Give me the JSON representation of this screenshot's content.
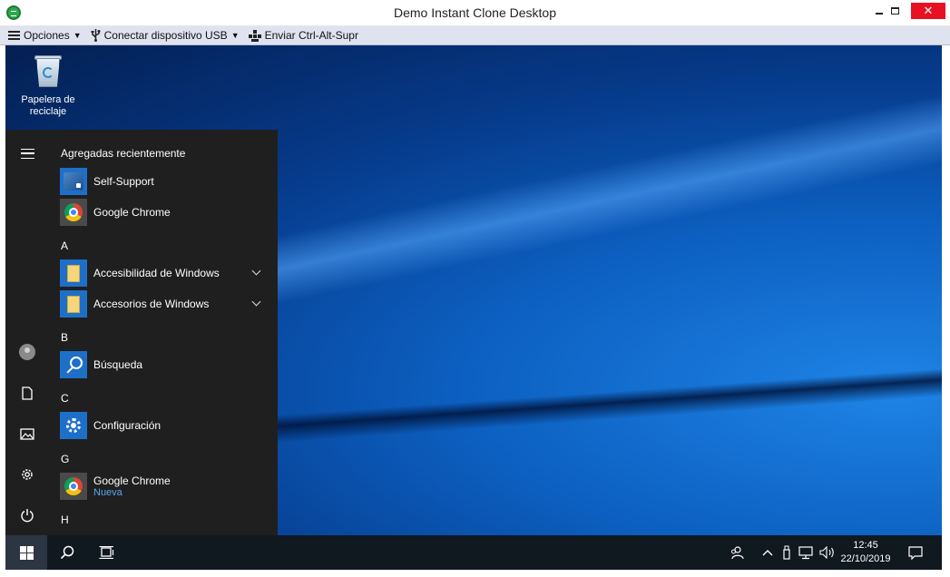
{
  "window": {
    "title": "Demo Instant Clone Desktop",
    "controls": {
      "minimize": "minimize",
      "maximize": "maximize",
      "close": "✕"
    }
  },
  "toolbar": {
    "options_label": "Opciones",
    "usb_label": "Conectar dispositivo USB",
    "ctrl_alt_del_label": "Enviar Ctrl-Alt-Supr"
  },
  "desktop": {
    "recycle_bin_label": "Papelera de reciclaje"
  },
  "start_menu": {
    "recent_heading": "Agregadas recientemente",
    "recent_apps": [
      {
        "label": "Self-Support",
        "icon": "self-support-icon"
      },
      {
        "label": "Google Chrome",
        "icon": "chrome-icon"
      }
    ],
    "groups": [
      {
        "letter": "A",
        "items": [
          {
            "label": "Accesibilidad de Windows",
            "icon": "folder-icon",
            "expandable": true
          },
          {
            "label": "Accesorios de Windows",
            "icon": "folder-icon",
            "expandable": true
          }
        ]
      },
      {
        "letter": "B",
        "items": [
          {
            "label": "Búsqueda",
            "icon": "search-icon"
          }
        ]
      },
      {
        "letter": "C",
        "items": [
          {
            "label": "Configuración",
            "icon": "gear-icon"
          }
        ]
      },
      {
        "letter": "G",
        "items": [
          {
            "label": "Google Chrome",
            "sub": "Nueva",
            "icon": "chrome-icon"
          }
        ]
      },
      {
        "letter": "H",
        "items": []
      }
    ],
    "rail_icons": [
      "menu-icon",
      "user-icon",
      "documents-icon",
      "pictures-icon",
      "settings-icon",
      "power-icon"
    ]
  },
  "taskbar": {
    "tray_icons": [
      "people-icon",
      "chevron-up-icon",
      "usb-icon",
      "network-icon",
      "volume-icon",
      "notifications-icon"
    ],
    "time": "12:45",
    "date": "22/10/2019"
  },
  "colors": {
    "accent": "#1e6fc8",
    "close_button": "#e81123",
    "start_menu_bg": "#1f1f1f",
    "taskbar_bg": "#101820",
    "toolbar_bg": "#dfe3f0"
  }
}
